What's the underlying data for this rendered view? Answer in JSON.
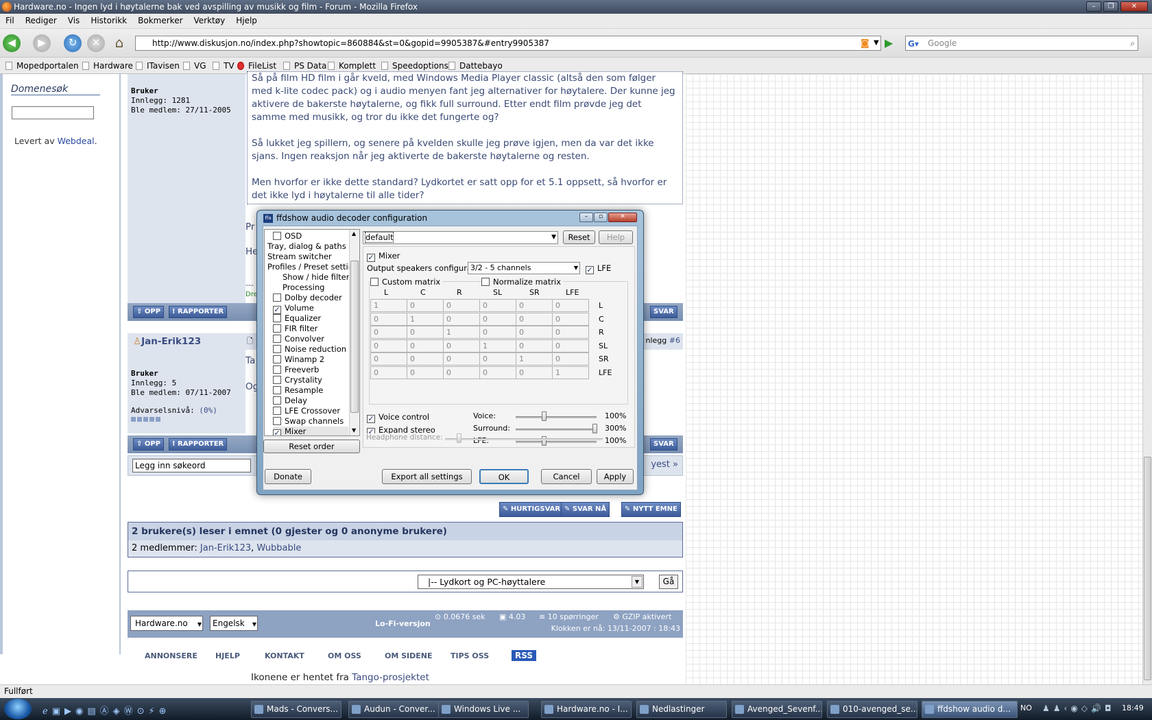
{
  "window": {
    "title": "Hardware.no - Ingen lyd i høytalerne bak ved avspilling av musikk og film - Forum - Mozilla Firefox"
  },
  "menu": [
    "Fil",
    "Rediger",
    "Vis",
    "Historikk",
    "Bokmerker",
    "Verktøy",
    "Hjelp"
  ],
  "nav": {
    "url": "http://www.diskusjon.no/index.php?showtopic=860884&st=0&gopid=9905387&#entry9905387",
    "search_placeholder": "Google"
  },
  "bookmarks": [
    "Mopedportalen",
    "Hardware",
    "ITavisen",
    "VG",
    "TV",
    "FileList",
    "PS Data",
    "Komplett",
    "Speedoptions",
    "Dattebayo"
  ],
  "sidebar": {
    "title": "Domenesøk",
    "credit_prefix": "Levert av",
    "credit_link": "Webdeal",
    "credit_suffix": "."
  },
  "post1": {
    "role": "Bruker",
    "posts": "Innlegg: 1281",
    "joined": "Ble medlem: 27/11-2005",
    "p1": "Så på film HD film i går kveld, med Windows Media Player classic (altså den som følger med k-lite codec pack) og i audio menyen fant jeg alternativer for høytalere. Der kunne jeg aktivere de bakerste høytalerne, og fikk full surround. Etter endt film prøvde jeg det samme med musikk, og tror du ikke det fungerte og?",
    "p2": "Så lukket jeg spillern, og senere på kvelden skulle jeg prøve igjen, men da var det ikke sjans. Ingen reaksjon når jeg aktiverte de bakerste høytalerne og resten.",
    "p3": "Men hvorfor er ikke dette standard? Lydkortet er satt opp for et 5.1 oppsett, så hvorfor er det ikke lyd i høytalerne til alle tider?",
    "frag1": "Pr",
    "frag2": "He",
    "frag3": "---",
    "frag4": "Dre"
  },
  "post2": {
    "username": "Jan-Erik123",
    "role": "Bruker",
    "posts": "Innlegg: 5",
    "joined": "Ble medlem: 07/11-2007",
    "warn_label": "Advarselsnivå:",
    "warn_value": "(0%)",
    "right_label": "nlegg",
    "right_num": "#6",
    "frag1": "Ta",
    "frag2": "Og"
  },
  "buttons": {
    "up": "OPP",
    "report": "RAPPORTER",
    "reply": "SVAR",
    "quick": "HURTIGSVAR",
    "reply_now": "SVAR NÅ",
    "new_topic": "NYTT EMNE",
    "go": "Gå"
  },
  "search_topic": {
    "value": "Legg inn søkeord",
    "newest": "yest »"
  },
  "readers": {
    "title": "2 brukere(s) leser i emnet (0 gjester og 0 anonyme brukere)",
    "label": "2 medlemmer:",
    "u1": "Jan-Erik123",
    "u2": "Wubbable"
  },
  "forumjump": {
    "value": "|-- Lydkort og PC-høyttalere"
  },
  "footer": {
    "skin": "Hardware.no",
    "lang": "Engelsk",
    "lofi": "Lo-Fi-versjon",
    "time": "0.0676 sek",
    "load": "4.03",
    "queries": "10 spørringer",
    "gzip": "GZIP aktivert",
    "clock": "Klokken er nå: 13/11-2007 : 18:43"
  },
  "links": [
    "ANNONSERE",
    "HJELP",
    "KONTAKT",
    "OM OSS",
    "OM SIDENE",
    "TIPS OSS",
    "RSS"
  ],
  "credit": {
    "text": "Ikonene er hentet fra",
    "link": "Tango-prosjektet"
  },
  "status": "Fullført",
  "dialog": {
    "title": "ffdshow audio decoder configuration",
    "preset": "default",
    "reset": "Reset",
    "help": "Help",
    "tree": [
      {
        "label": "OSD",
        "check": false,
        "indent": 1
      },
      {
        "label": "Tray, dialog & paths",
        "check": null,
        "indent": 0
      },
      {
        "label": "Stream switcher",
        "check": null,
        "indent": 0
      },
      {
        "label": "Profiles / Preset settings",
        "check": null,
        "indent": 0
      },
      {
        "label": "Show / hide filters",
        "check": null,
        "indent": 2
      },
      {
        "label": "Processing",
        "check": null,
        "indent": 2
      },
      {
        "label": "Dolby decoder",
        "check": false,
        "indent": 1
      },
      {
        "label": "Volume",
        "check": true,
        "indent": 1
      },
      {
        "label": "Equalizer",
        "check": false,
        "indent": 1
      },
      {
        "label": "FIR filter",
        "check": false,
        "indent": 1
      },
      {
        "label": "Convolver",
        "check": false,
        "indent": 1
      },
      {
        "label": "Noise reduction",
        "check": false,
        "indent": 1
      },
      {
        "label": "Winamp 2",
        "check": false,
        "indent": 1
      },
      {
        "label": "Freeverb",
        "check": false,
        "indent": 1
      },
      {
        "label": "Crystality",
        "check": false,
        "indent": 1
      },
      {
        "label": "Resample",
        "check": false,
        "indent": 1
      },
      {
        "label": "Delay",
        "check": false,
        "indent": 1
      },
      {
        "label": "LFE Crossover",
        "check": false,
        "indent": 1
      },
      {
        "label": "Swap channels",
        "check": false,
        "indent": 1
      },
      {
        "label": "Mixer",
        "check": true,
        "indent": 1
      }
    ],
    "reset_order": "Reset order",
    "mixer": "Mixer",
    "out_label": "Output speakers configuration:",
    "out_value": "3/2 - 5 channels",
    "lfe": "LFE",
    "custom_matrix": "Custom matrix",
    "normalize_matrix": "Normalize matrix",
    "cols": [
      "L",
      "C",
      "R",
      "SL",
      "SR",
      "LFE"
    ],
    "rows": [
      "L",
      "C",
      "R",
      "SL",
      "SR",
      "LFE"
    ],
    "matrix": [
      [
        "1",
        "0",
        "0",
        "0",
        "0",
        "0"
      ],
      [
        "0",
        "1",
        "0",
        "0",
        "0",
        "0"
      ],
      [
        "0",
        "0",
        "1",
        "0",
        "0",
        "0"
      ],
      [
        "0",
        "0",
        "0",
        "1",
        "0",
        "0"
      ],
      [
        "0",
        "0",
        "0",
        "0",
        "1",
        "0"
      ],
      [
        "0",
        "0",
        "0",
        "0",
        "0",
        "1"
      ]
    ],
    "voice_control": "Voice control",
    "expand_stereo": "Expand stereo",
    "voice_label": "Voice:",
    "voice_val": "100%",
    "surround_label": "Surround:",
    "surround_val": "300%",
    "lfe_label": "LFE:",
    "lfe_val": "100%",
    "headphone": "Headphone distance:",
    "donate": "Donate",
    "export": "Export all settings",
    "ok": "OK",
    "cancel": "Cancel",
    "apply": "Apply"
  },
  "taskbar": {
    "tasks": [
      "Mads - Convers...",
      "Audun - Conver...",
      "Windows Live ...",
      "Hardware.no - I...",
      "Nedlastinger",
      "Avenged_Sevenf...",
      "010-avenged_se...",
      "ffdshow audio d..."
    ],
    "lang": "NO",
    "clock": "18:49"
  }
}
